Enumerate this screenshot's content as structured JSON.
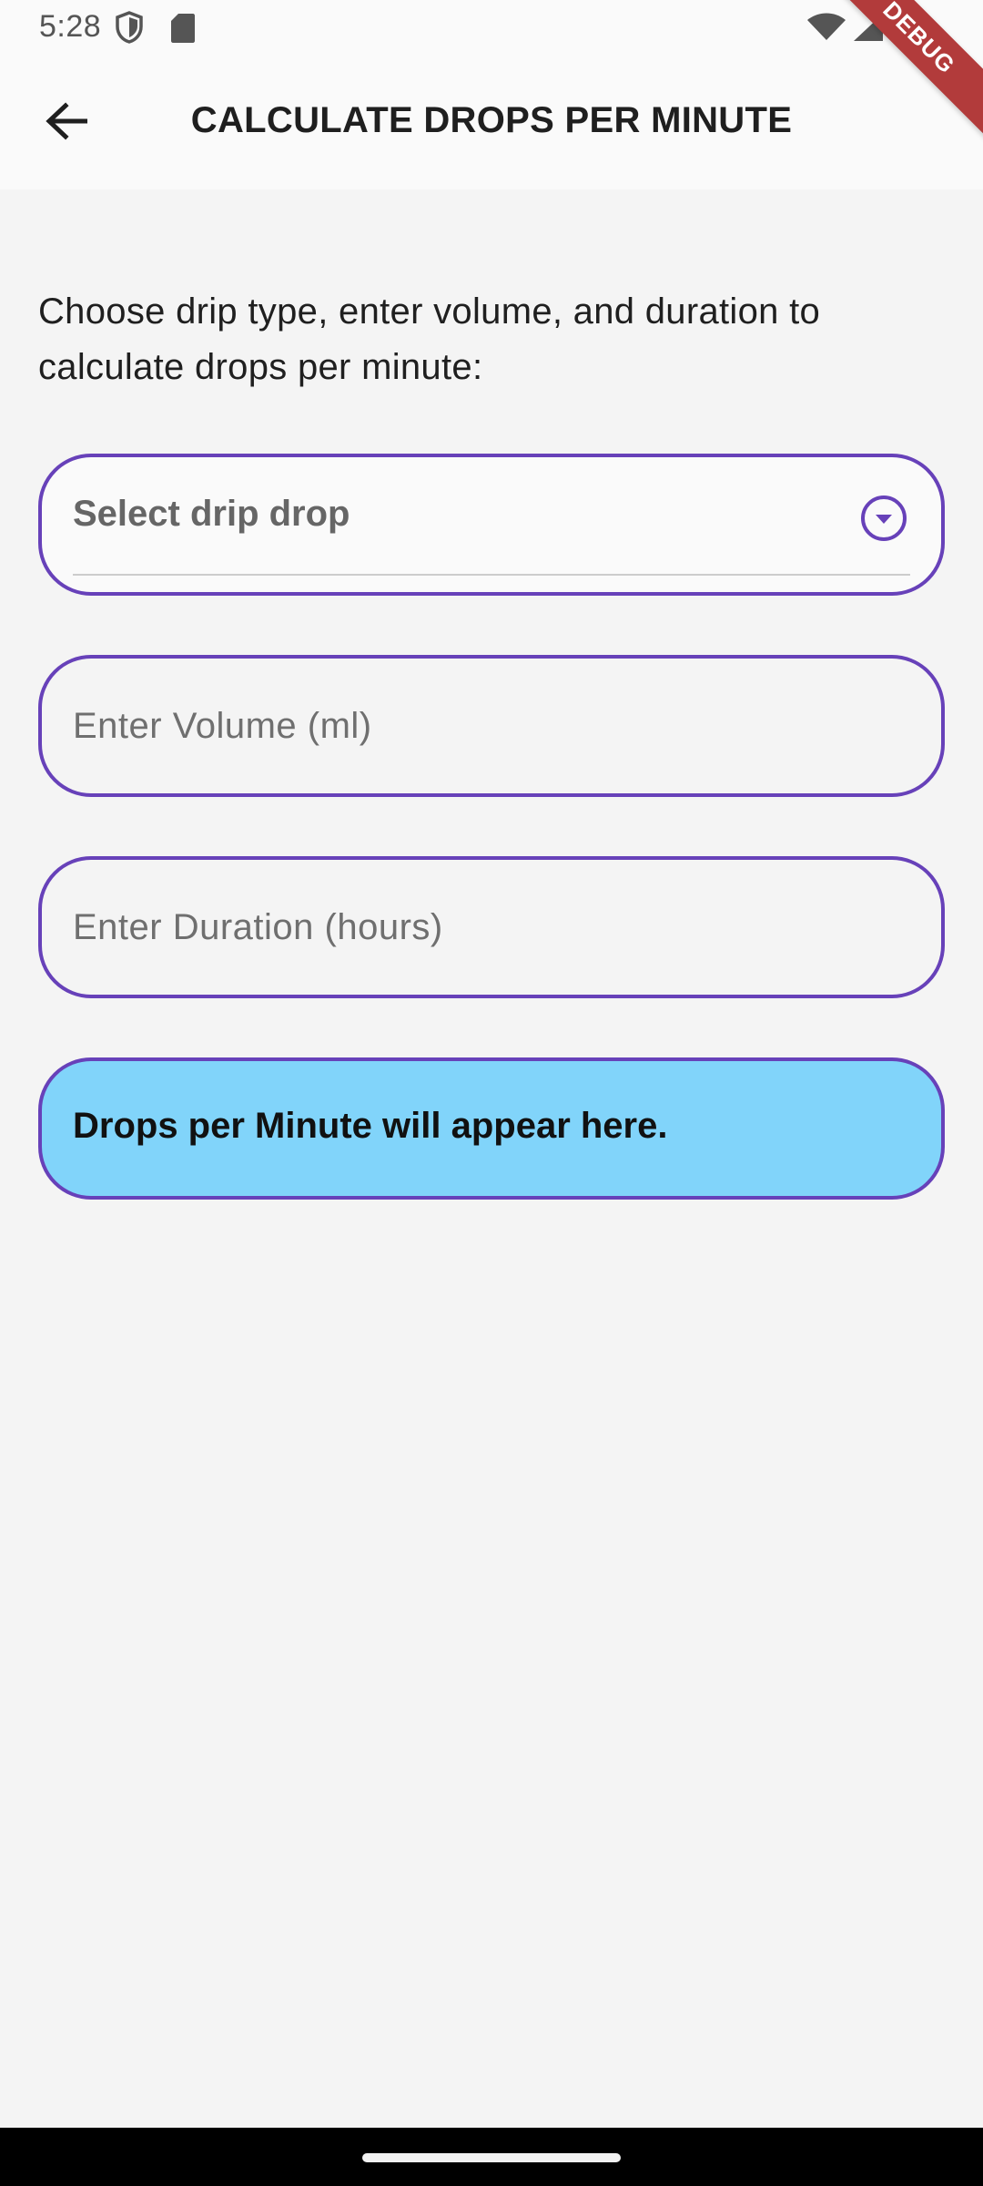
{
  "status_bar": {
    "time": "5:28",
    "icons": [
      "shield-icon",
      "sd-card-icon",
      "wifi-icon",
      "signal-icon",
      "battery-icon"
    ]
  },
  "debug_banner": "DEBUG",
  "app_bar": {
    "title": "CALCULATE DROPS PER MINUTE",
    "back_icon": "arrow-back-icon"
  },
  "instructions": "Choose drip type, enter volume, and duration to calculate drops per minute:",
  "form": {
    "drip_dropdown": {
      "label": "Select drip drop",
      "icon": "chevron-down-circle-icon"
    },
    "volume_input": {
      "value": "",
      "placeholder": "Enter Volume (ml)"
    },
    "duration_input": {
      "value": "",
      "placeholder": "Enter Duration (hours)"
    }
  },
  "result": {
    "text": "Drops per Minute will appear here."
  },
  "colors": {
    "accent": "#6741b9",
    "result_background": "#81d4fa",
    "background": "#f4f4f4",
    "debug_ribbon": "#b23b3b"
  }
}
